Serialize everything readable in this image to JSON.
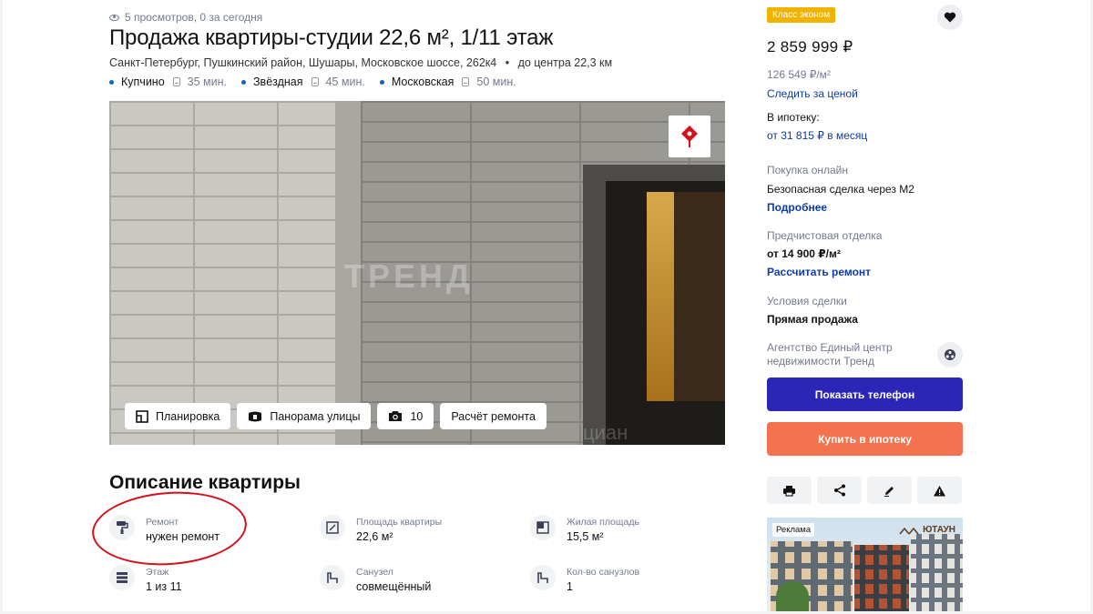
{
  "header": {
    "views": "5 просмотров, 0 за сегодня",
    "title": "Продажа квартиры-студии 22,6 м², 1/11 этаж",
    "address": "Санкт-Петербург, Пушкинский район, Шушары, Московское шоссе, 262к4",
    "distance": "до центра 22,3 км",
    "metro": [
      {
        "name": "Купчино",
        "time": "35 мин."
      },
      {
        "name": "Звёздная",
        "time": "45 мин."
      },
      {
        "name": "Московская",
        "time": "50 мин."
      }
    ]
  },
  "photo": {
    "watermark": "ТРЕНД",
    "watermark2": "циан",
    "actions": [
      {
        "label": "Планировка",
        "icon": "floorplan-icon"
      },
      {
        "label": "Панорама улицы",
        "icon": "street-view-icon"
      },
      {
        "label": "10",
        "icon": "camera-icon"
      },
      {
        "label": "Расчёт ремонта",
        "icon": ""
      }
    ]
  },
  "description": {
    "title": "Описание квартиры",
    "features": [
      {
        "label": "Ремонт",
        "value": "нужен ремонт",
        "icon": "paint-roller-icon"
      },
      {
        "label": "Площадь квартиры",
        "value": "22,6 м²",
        "icon": "area-icon"
      },
      {
        "label": "Жилая площадь",
        "value": "15,5 м²",
        "icon": "living-area-icon"
      },
      {
        "label": "Этаж",
        "value": "1 из 11",
        "icon": "floors-icon"
      },
      {
        "label": "Санузел",
        "value": "совмещённый",
        "icon": "bathroom-icon"
      },
      {
        "label": "Кол-во санузлов",
        "value": "1",
        "icon": "bathroom-count-icon"
      }
    ]
  },
  "sidebar": {
    "badge": "Класс эконом",
    "price": "2 859 999 ₽",
    "price_per_m": "126 549 ₽/м²",
    "follow_price": "Следить за ценой",
    "mortgage_label": "В ипотеку:",
    "mortgage_value": "от 31 815 ₽ в месяц",
    "online_label": "Покупка онлайн",
    "online_value": "Безопасная сделка через М2",
    "online_link": "Подробнее",
    "finish_label": "Предчистовая отделка",
    "finish_value": "от 14 900 ₽/м²",
    "finish_link": "Рассчитать ремонт",
    "terms_label": "Условия сделки",
    "terms_value": "Прямая продажа",
    "agency": "Агентство Единый центр недвижимости Тренд",
    "phone_button": "Показать телефон",
    "mortgage_button": "Купить в ипотеку",
    "ad_label": "Реклама",
    "ad_brand": "ЮТАУН"
  },
  "colors": {
    "accent": "#2c26b8",
    "mortgage": "#f4734e",
    "badge": "#f2b200",
    "link": "#0e3aa8",
    "annotation": "#d4101a"
  }
}
